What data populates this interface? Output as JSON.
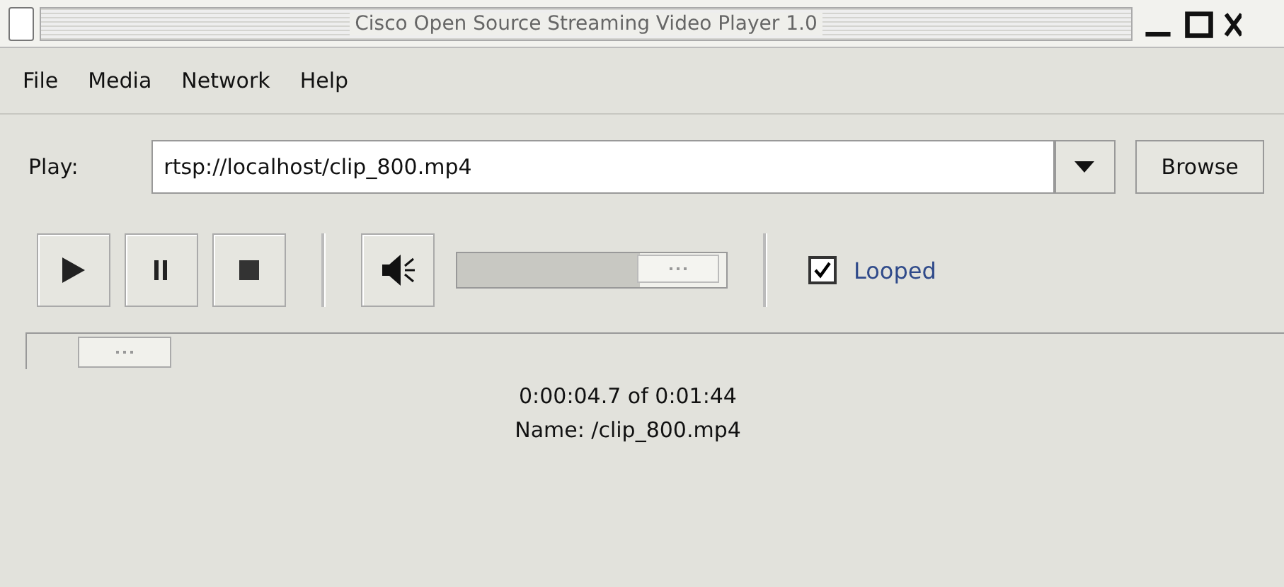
{
  "window": {
    "title": "Cisco Open Source Streaming Video Player 1.0"
  },
  "menu": [
    "File",
    "Media",
    "Network",
    "Help"
  ],
  "play": {
    "label": "Play:",
    "value": "rtsp://localhost/clip_800.mp4",
    "browse": "Browse"
  },
  "volume": {
    "level": 0.68
  },
  "looped": {
    "label": "Looped",
    "checked": true
  },
  "seek": {
    "level": 0.04
  },
  "info": [
    "0:00:04.7 of 0:01:44",
    "Name: /clip_800.mp4"
  ]
}
